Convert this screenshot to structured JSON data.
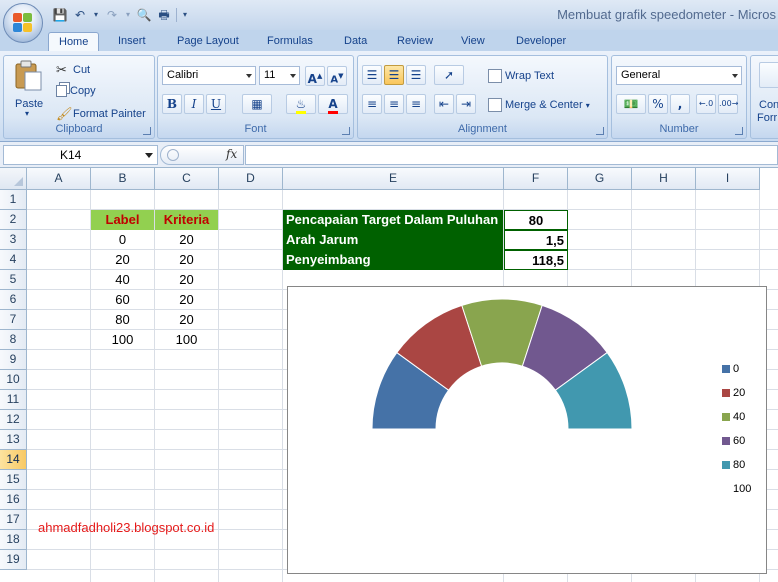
{
  "window": {
    "title": "Membuat grafik speedometer - Micros"
  },
  "tabs": [
    "Home",
    "Insert",
    "Page Layout",
    "Formulas",
    "Data",
    "Review",
    "View",
    "Developer"
  ],
  "ribbon": {
    "clipboard": {
      "label": "Clipboard",
      "paste": "Paste",
      "cut": "Cut",
      "copy": "Copy",
      "format_painter": "Format Painter"
    },
    "font": {
      "label": "Font",
      "name": "Calibri",
      "size": "11"
    },
    "alignment": {
      "label": "Alignment",
      "wrap_text": "Wrap Text",
      "merge_center": "Merge & Center"
    },
    "number": {
      "label": "Number",
      "format": "General"
    },
    "styles": {
      "cond1": "Con",
      "cond2": "Forr"
    }
  },
  "formula_bar": {
    "name_box": "K14",
    "fx": "fx"
  },
  "columns": [
    "A",
    "B",
    "C",
    "D",
    "E",
    "F",
    "G",
    "H",
    "I"
  ],
  "rows": [
    "1",
    "2",
    "3",
    "4",
    "5",
    "6",
    "7",
    "8",
    "9",
    "10",
    "11",
    "12",
    "13",
    "14",
    "15",
    "16",
    "17",
    "18",
    "19"
  ],
  "selected_row": "14",
  "table": {
    "headers": [
      "Label",
      "Kriteria"
    ],
    "rows": [
      [
        "0",
        "20"
      ],
      [
        "20",
        "20"
      ],
      [
        "40",
        "20"
      ],
      [
        "60",
        "20"
      ],
      [
        "80",
        "20"
      ],
      [
        "100",
        "100"
      ]
    ]
  },
  "info": [
    {
      "label": "Pencapaian Target Dalam Puluhan",
      "value": "80"
    },
    {
      "label": "Arah Jarum",
      "value": "1,5"
    },
    {
      "label": "Penyeimbang",
      "value": "118,5"
    }
  ],
  "blog": "ahmadfadholi23.blogspot.co.id",
  "colors": {
    "series": [
      "#4572a7",
      "#aa4643",
      "#89a54e",
      "#71588f",
      "#4198af",
      "#ffffff"
    ]
  },
  "chart_data": {
    "type": "pie",
    "variant": "doughnut",
    "categories": [
      "0",
      "20",
      "40",
      "60",
      "80",
      "100"
    ],
    "values": [
      20,
      20,
      20,
      20,
      20,
      100
    ],
    "legend": "right"
  }
}
